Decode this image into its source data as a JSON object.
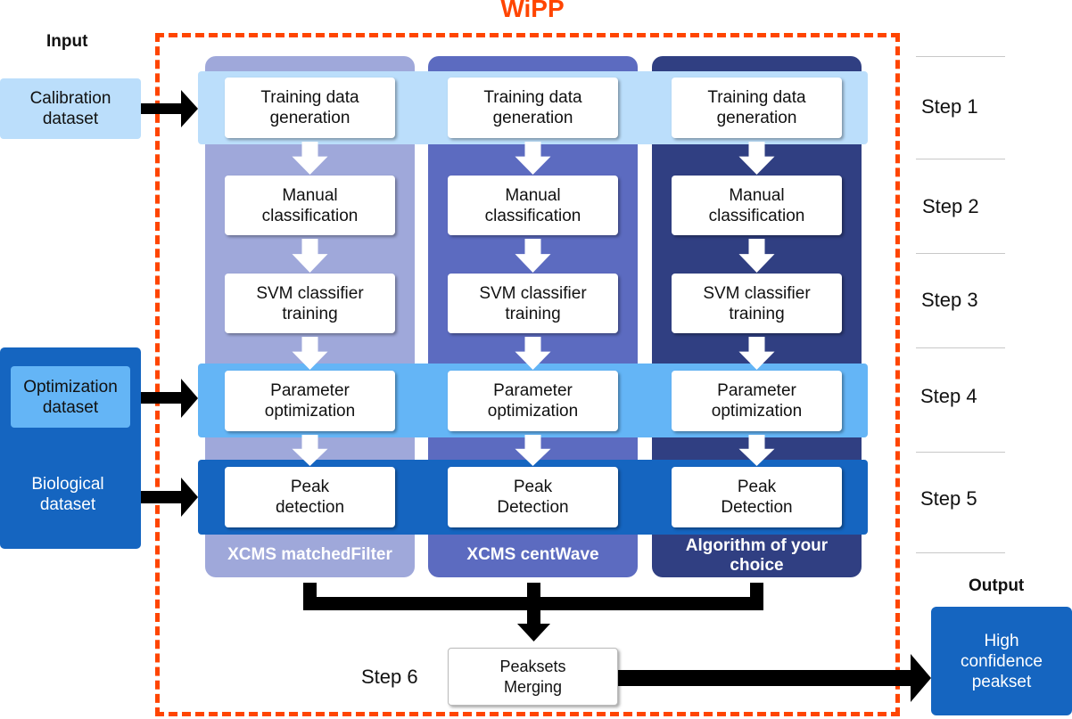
{
  "title": "WiPP",
  "input_heading": "Input",
  "output_heading": "Output",
  "inputs": {
    "calibration": "Calibration\ndataset",
    "optimization": "Optimization\ndataset",
    "biological": "Biological\ndataset"
  },
  "columns": [
    {
      "label": "XCMS matchedFilter",
      "boxes": [
        "Training data\ngeneration",
        "Manual\nclassification",
        "SVM classifier\ntraining",
        "Parameter\noptimization",
        "Peak\ndetection"
      ]
    },
    {
      "label": "XCMS centWave",
      "boxes": [
        "Training data\ngeneration",
        "Manual\nclassification",
        "SVM classifier\ntraining",
        "Parameter\noptimization",
        "Peak\nDetection"
      ]
    },
    {
      "label": "Algorithm of your\nchoice",
      "boxes": [
        "Training data\ngeneration",
        "Manual\nclassification",
        "SVM classifier\ntraining",
        "Parameter\noptimization",
        "Peak\nDetection"
      ]
    }
  ],
  "steps": [
    "Step 1",
    "Step 2",
    "Step 3",
    "Step 4",
    "Step 5",
    "Step 6"
  ],
  "merge_box": "Peaksets\nMerging",
  "output_box": "High\nconfidence\npeakset",
  "colors": {
    "frame": "#ff4500",
    "col1": "#9fa8da",
    "col2": "#5c6bc0",
    "col3": "#303f82",
    "band_step1": "#bbdefb",
    "band_step4": "#64b5f6",
    "band_step5": "#1565c0",
    "output": "#1565c0"
  }
}
